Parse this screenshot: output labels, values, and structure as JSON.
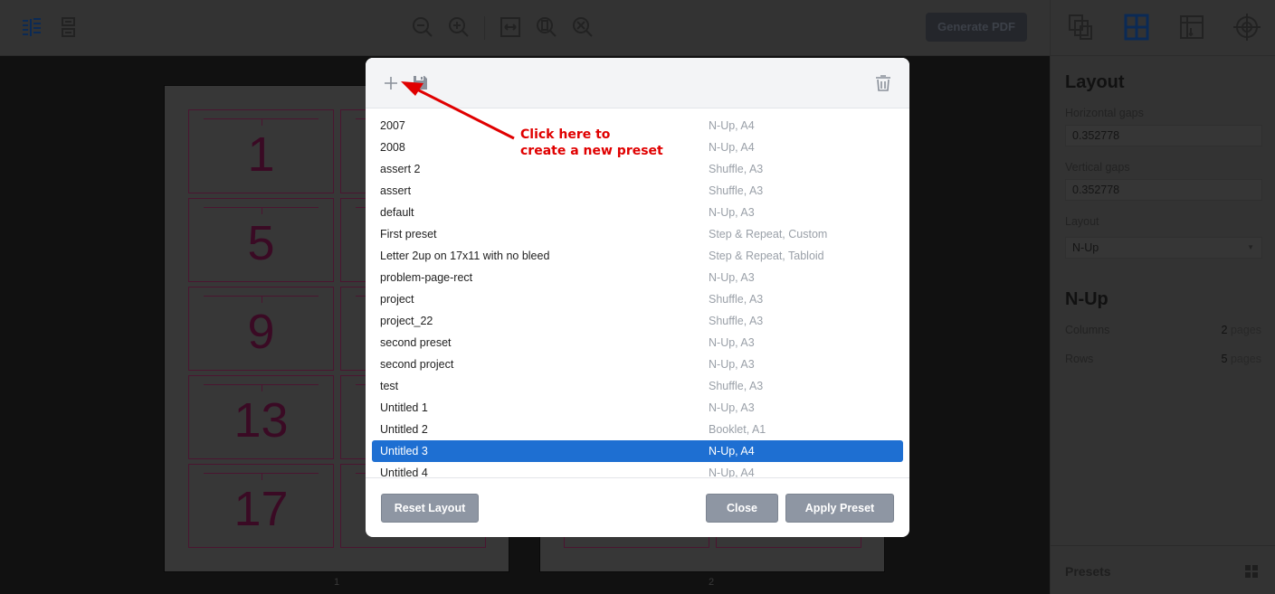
{
  "toolbar": {
    "generate_label": "Generate PDF"
  },
  "sidebar": {
    "layout_title": "Layout",
    "hgap_label": "Horizontal gaps",
    "hgap_value": "0.352778",
    "vgap_label": "Vertical gaps",
    "vgap_value": "0.352778",
    "layout_label": "Layout",
    "layout_value": "N-Up",
    "nup_title": "N-Up",
    "columns_label": "Columns",
    "columns_value": "2",
    "columns_unit": "pages",
    "rows_label": "Rows",
    "rows_value": "5",
    "rows_unit": "pages",
    "presets_label": "Presets"
  },
  "canvas": {
    "page_numbers": [
      "1",
      "2"
    ],
    "cell_numbers": [
      "1",
      "5",
      "9",
      "13",
      "17"
    ]
  },
  "modal": {
    "presets": [
      {
        "name": "2007",
        "type": "N-Up, A4"
      },
      {
        "name": "2008",
        "type": "N-Up, A4"
      },
      {
        "name": "assert 2",
        "type": "Shuffle, A3"
      },
      {
        "name": "assert",
        "type": "Shuffle, A3"
      },
      {
        "name": "default",
        "type": "N-Up, A3"
      },
      {
        "name": "First preset",
        "type": "Step & Repeat, Custom"
      },
      {
        "name": "Letter 2up on 17x11 with no bleed",
        "type": "Step & Repeat, Tabloid"
      },
      {
        "name": "problem-page-rect",
        "type": "N-Up, A3"
      },
      {
        "name": "project",
        "type": "Shuffle, A3"
      },
      {
        "name": "project_22",
        "type": "Shuffle, A3"
      },
      {
        "name": "second preset",
        "type": "N-Up, A3"
      },
      {
        "name": "second project",
        "type": "N-Up, A3"
      },
      {
        "name": "test",
        "type": "Shuffle, A3"
      },
      {
        "name": "Untitled 1",
        "type": "N-Up, A3"
      },
      {
        "name": "Untitled 2",
        "type": "Booklet, A1"
      },
      {
        "name": "Untitled 3",
        "type": "N-Up, A4",
        "selected": true
      },
      {
        "name": "Untitled 4",
        "type": "N-Up, A4"
      }
    ],
    "reset_label": "Reset Layout",
    "close_label": "Close",
    "apply_label": "Apply Preset"
  },
  "annotation": {
    "line1": "Click here to",
    "line2": "create a new preset",
    "color": "#e00000"
  },
  "colors": {
    "selected": "#1e6fd2",
    "accent_icon": "#0b2a55"
  }
}
